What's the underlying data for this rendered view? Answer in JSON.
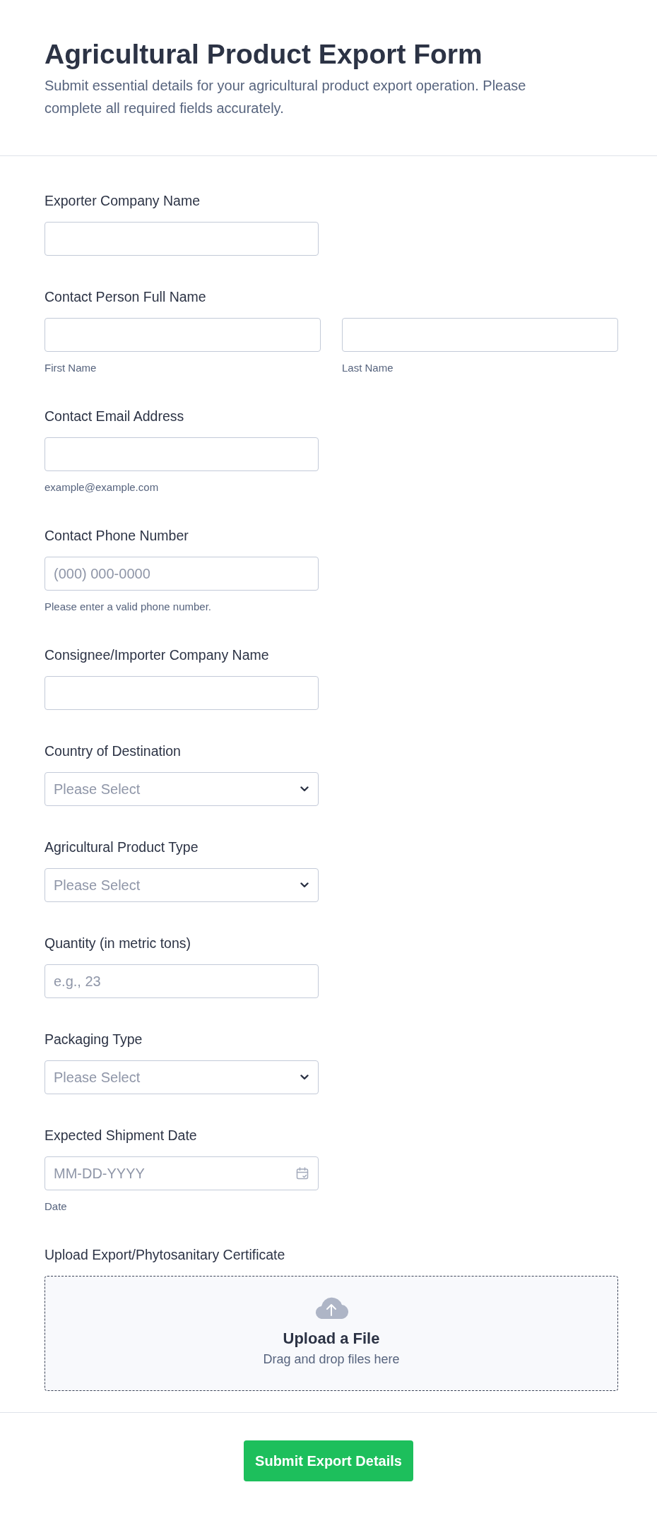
{
  "form": {
    "title": "Agricultural Product Export Form",
    "description": "Submit essential details for your agricultural product export operation. Please complete all required fields accurately."
  },
  "fields": [
    {
      "kind": "text",
      "label": "Exporter Company Name"
    },
    {
      "kind": "name",
      "label": "Contact Person Full Name",
      "parts": [
        {
          "sublabel": "First Name"
        },
        {
          "sublabel": "Last Name"
        }
      ]
    },
    {
      "kind": "text",
      "label": "Contact Email Address",
      "sublabel": "example@example.com"
    },
    {
      "kind": "text",
      "label": "Contact Phone Number",
      "placeholder": "(000) 000-0000",
      "sublabel": "Please enter a valid phone number."
    },
    {
      "kind": "text",
      "label": "Consignee/Importer Company Name"
    },
    {
      "kind": "select",
      "label": "Country of Destination",
      "placeholder": "Please Select"
    },
    {
      "kind": "select",
      "label": "Agricultural Product Type",
      "placeholder": "Please Select"
    },
    {
      "kind": "text",
      "label": "Quantity (in metric tons)",
      "placeholder": "e.g., 23"
    },
    {
      "kind": "select",
      "label": "Packaging Type",
      "placeholder": "Please Select"
    },
    {
      "kind": "date",
      "label": "Expected Shipment Date",
      "placeholder": "MM-DD-YYYY",
      "sublabel": "Date"
    },
    {
      "kind": "upload",
      "label": "Upload Export/Phytosanitary Certificate",
      "title": "Upload a File",
      "hint": "Drag and drop files here"
    }
  ],
  "submit_button": {
    "label": "Submit Export Details"
  }
}
